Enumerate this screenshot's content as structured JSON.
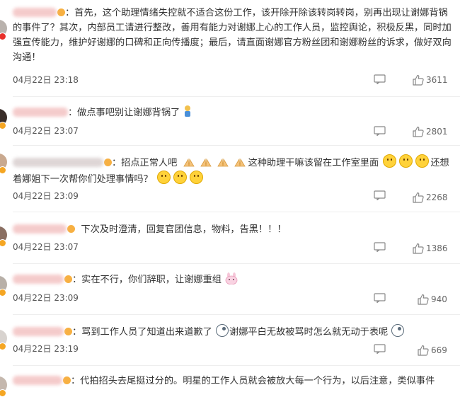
{
  "comments": [
    {
      "text": "：首先，这个助理情绪失控就不适合这份工作，该开除开除该转岗转岗，别再出现让谢娜背锅的事件了？其次，内部员工请进行整改，善用有能力对谢娜上心的工作人员，监控舆论，积极反黑，同时加强宣传能力，维护好谢娜的口碑和正向传播度；最后，请直面谢娜官方粉丝团和谢娜粉丝的诉求，做好双向沟通！",
      "timestamp": "04月22日 23:18",
      "likes": "3611"
    },
    {
      "text": "：做点事吧别让谢娜背锅了",
      "timestamp": "04月22日 23:07",
      "likes": "2801"
    },
    {
      "text_a": "：招点正常人吧",
      "text_b": "这种助理干嘛该留在工作室里面",
      "text_c": "还想着娜姐下一次帮你们处理事情吗？",
      "timestamp": "04月22日 23:09",
      "likes": "2268"
    },
    {
      "text": "下次及时澄清，回复官团信息，物料，告黑！！！",
      "timestamp": "04月22日 23:07",
      "likes": "1386"
    },
    {
      "text": "：实在不行，你们辞职，让谢娜重组",
      "timestamp": "04月22日 23:09",
      "likes": "940"
    },
    {
      "text_a": "：骂到工作人员了知道出来道歉了",
      "text_b": "谢娜平白无故被骂时怎么就无动于表呢",
      "timestamp": "04月22日 23:19",
      "likes": "669"
    },
    {
      "text": "：代拍招头去尾挺过分的。明星的工作人员就会被放大每一个行为，以后注意，类似事件"
    }
  ],
  "icons": {
    "reply": "reply-icon",
    "like": "thumbs-up-icon",
    "badge": "verified-badge-icon"
  },
  "colors": {
    "text": "#333333",
    "meta": "#666666",
    "badge": "#f7b042"
  }
}
